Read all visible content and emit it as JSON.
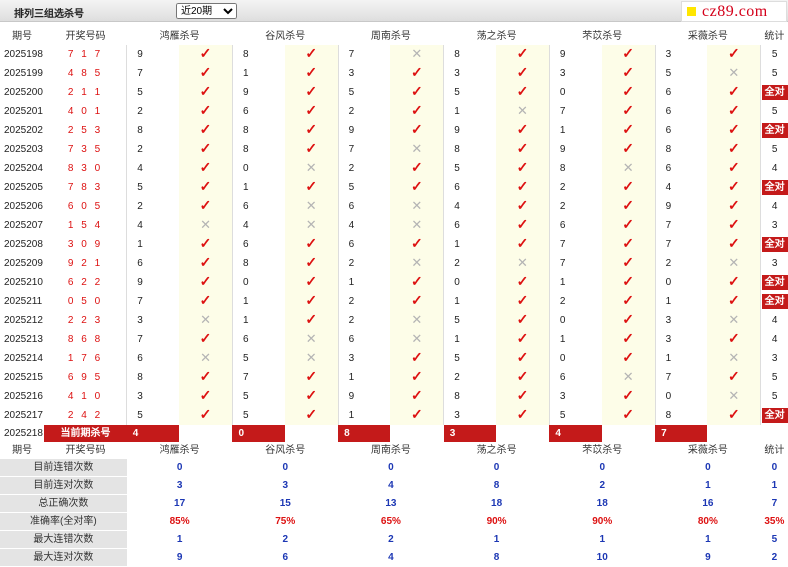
{
  "topbar": {
    "title": "排列三组选杀号",
    "range_select": "近20期",
    "logo": "cz89.com"
  },
  "colors": {
    "correct": "#dd1111",
    "wrong": "#b4b4b4",
    "badge": "#c41a1a",
    "stat_value": "#1c37b4"
  },
  "icons": {
    "correct": "check-icon",
    "wrong": "cross-icon"
  },
  "header": {
    "period": "期号",
    "draw": "开奖号码",
    "experts": [
      "鸿雁杀号",
      "谷风杀号",
      "周南杀号",
      "荡之杀号",
      "芣苡杀号",
      "采薇杀号"
    ],
    "stat": "统计"
  },
  "rows": [
    {
      "period": "2025198",
      "draw": "7 1 7",
      "kills": [
        "9",
        "8",
        "7",
        "8",
        "9",
        "3"
      ],
      "results": [
        1,
        1,
        0,
        1,
        1,
        1
      ],
      "stat": "5"
    },
    {
      "period": "2025199",
      "draw": "4 8 5",
      "kills": [
        "7",
        "1",
        "3",
        "3",
        "3",
        "5"
      ],
      "results": [
        1,
        1,
        1,
        1,
        1,
        0
      ],
      "stat": "5"
    },
    {
      "period": "2025200",
      "draw": "2 1 1",
      "kills": [
        "5",
        "9",
        "5",
        "5",
        "0",
        "6"
      ],
      "results": [
        1,
        1,
        1,
        1,
        1,
        1
      ],
      "stat": "全对"
    },
    {
      "period": "2025201",
      "draw": "4 0 1",
      "kills": [
        "2",
        "6",
        "2",
        "1",
        "7",
        "6"
      ],
      "results": [
        1,
        1,
        1,
        0,
        1,
        1
      ],
      "stat": "5"
    },
    {
      "period": "2025202",
      "draw": "2 5 3",
      "kills": [
        "8",
        "8",
        "9",
        "9",
        "1",
        "6"
      ],
      "results": [
        1,
        1,
        1,
        1,
        1,
        1
      ],
      "stat": "全对"
    },
    {
      "period": "2025203",
      "draw": "7 3 5",
      "kills": [
        "2",
        "8",
        "7",
        "8",
        "9",
        "8"
      ],
      "results": [
        1,
        1,
        0,
        1,
        1,
        1
      ],
      "stat": "5"
    },
    {
      "period": "2025204",
      "draw": "8 3 0",
      "kills": [
        "4",
        "0",
        "2",
        "5",
        "8",
        "6"
      ],
      "results": [
        1,
        0,
        1,
        1,
        0,
        1
      ],
      "stat": "4"
    },
    {
      "period": "2025205",
      "draw": "7 8 3",
      "kills": [
        "5",
        "1",
        "5",
        "6",
        "2",
        "4"
      ],
      "results": [
        1,
        1,
        1,
        1,
        1,
        1
      ],
      "stat": "全对"
    },
    {
      "period": "2025206",
      "draw": "6 0 5",
      "kills": [
        "2",
        "6",
        "6",
        "4",
        "2",
        "9"
      ],
      "results": [
        1,
        0,
        0,
        1,
        1,
        1
      ],
      "stat": "4"
    },
    {
      "period": "2025207",
      "draw": "1 5 4",
      "kills": [
        "4",
        "4",
        "4",
        "6",
        "6",
        "7"
      ],
      "results": [
        0,
        0,
        0,
        1,
        1,
        1
      ],
      "stat": "3"
    },
    {
      "period": "2025208",
      "draw": "3 0 9",
      "kills": [
        "1",
        "6",
        "6",
        "1",
        "7",
        "7"
      ],
      "results": [
        1,
        1,
        1,
        1,
        1,
        1
      ],
      "stat": "全对"
    },
    {
      "period": "2025209",
      "draw": "9 2 1",
      "kills": [
        "6",
        "8",
        "2",
        "2",
        "7",
        "2"
      ],
      "results": [
        1,
        1,
        0,
        0,
        1,
        0
      ],
      "stat": "3"
    },
    {
      "period": "2025210",
      "draw": "6 2 2",
      "kills": [
        "9",
        "0",
        "1",
        "0",
        "1",
        "0"
      ],
      "results": [
        1,
        1,
        1,
        1,
        1,
        1
      ],
      "stat": "全对"
    },
    {
      "period": "2025211",
      "draw": "0 5 0",
      "kills": [
        "7",
        "1",
        "2",
        "1",
        "2",
        "1"
      ],
      "results": [
        1,
        1,
        1,
        1,
        1,
        1
      ],
      "stat": "全对"
    },
    {
      "period": "2025212",
      "draw": "2 2 3",
      "kills": [
        "3",
        "1",
        "2",
        "5",
        "0",
        "3"
      ],
      "results": [
        0,
        1,
        0,
        1,
        1,
        0
      ],
      "stat": "4"
    },
    {
      "period": "2025213",
      "draw": "8 6 8",
      "kills": [
        "7",
        "6",
        "6",
        "1",
        "1",
        "3"
      ],
      "results": [
        1,
        0,
        0,
        1,
        1,
        1
      ],
      "stat": "4"
    },
    {
      "period": "2025214",
      "draw": "1 7 6",
      "kills": [
        "6",
        "5",
        "3",
        "5",
        "0",
        "1"
      ],
      "results": [
        0,
        0,
        1,
        1,
        1,
        0
      ],
      "stat": "3"
    },
    {
      "period": "2025215",
      "draw": "6 9 5",
      "kills": [
        "8",
        "7",
        "1",
        "2",
        "6",
        "7"
      ],
      "results": [
        1,
        1,
        1,
        1,
        0,
        1
      ],
      "stat": "5"
    },
    {
      "period": "2025216",
      "draw": "4 1 0",
      "kills": [
        "3",
        "5",
        "9",
        "8",
        "3",
        "0"
      ],
      "results": [
        1,
        1,
        1,
        1,
        1,
        0
      ],
      "stat": "5"
    },
    {
      "period": "2025217",
      "draw": "2 4 2",
      "kills": [
        "5",
        "5",
        "1",
        "3",
        "5",
        "8"
      ],
      "results": [
        1,
        1,
        1,
        1,
        1,
        1
      ],
      "stat": "全对"
    }
  ],
  "current": {
    "period": "2025218",
    "label": "当前期杀号",
    "kills": [
      "4",
      "0",
      "8",
      "3",
      "4",
      "7"
    ]
  },
  "summary": {
    "rows": [
      {
        "label": "目前连错次数",
        "values": [
          "0",
          "0",
          "0",
          "0",
          "0",
          "0",
          "0"
        ],
        "red": false
      },
      {
        "label": "目前连对次数",
        "values": [
          "3",
          "3",
          "4",
          "8",
          "2",
          "1",
          "1"
        ],
        "red": false
      },
      {
        "label": "总正确次数",
        "values": [
          "17",
          "15",
          "13",
          "18",
          "18",
          "16",
          "7"
        ],
        "red": false
      },
      {
        "label": "准确率(全对率)",
        "values": [
          "85%",
          "75%",
          "65%",
          "90%",
          "90%",
          "80%",
          "35%"
        ],
        "red": true
      },
      {
        "label": "最大连错次数",
        "values": [
          "1",
          "2",
          "2",
          "1",
          "1",
          "1",
          "5"
        ],
        "red": false
      },
      {
        "label": "最大连对次数",
        "values": [
          "9",
          "6",
          "4",
          "8",
          "10",
          "9",
          "2"
        ],
        "red": false
      }
    ]
  }
}
